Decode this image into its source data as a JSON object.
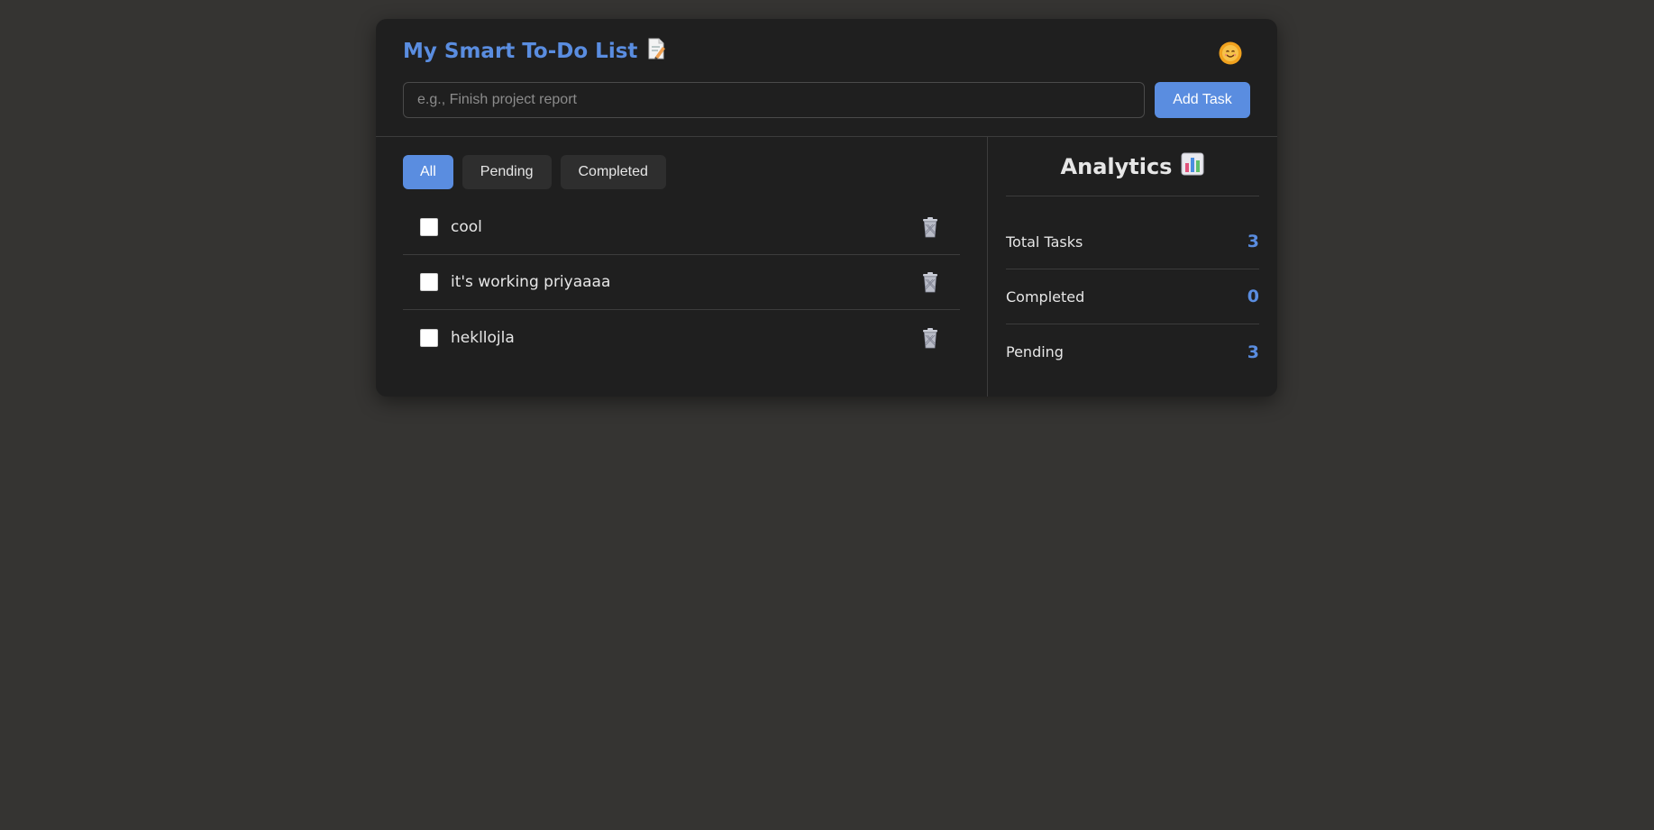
{
  "app": {
    "title": "My Smart To-Do List",
    "accent_color": "#5a8de0",
    "title_icon": "memo-icon",
    "theme_icon": "sun-smile-icon"
  },
  "input": {
    "placeholder": "e.g., Finish project report",
    "value": "",
    "add_label": "Add Task"
  },
  "filters": [
    {
      "label": "All",
      "active": true
    },
    {
      "label": "Pending",
      "active": false
    },
    {
      "label": "Completed",
      "active": false
    }
  ],
  "tasks": [
    {
      "text": "cool",
      "completed": false
    },
    {
      "text": "it's working priyaaaa",
      "completed": false
    },
    {
      "text": "hekllojla",
      "completed": false
    }
  ],
  "analytics": {
    "title": "Analytics",
    "title_icon": "bar-chart-icon",
    "stats": [
      {
        "label": "Total Tasks",
        "value": "3"
      },
      {
        "label": "Completed",
        "value": "0"
      },
      {
        "label": "Pending",
        "value": "3"
      }
    ]
  }
}
